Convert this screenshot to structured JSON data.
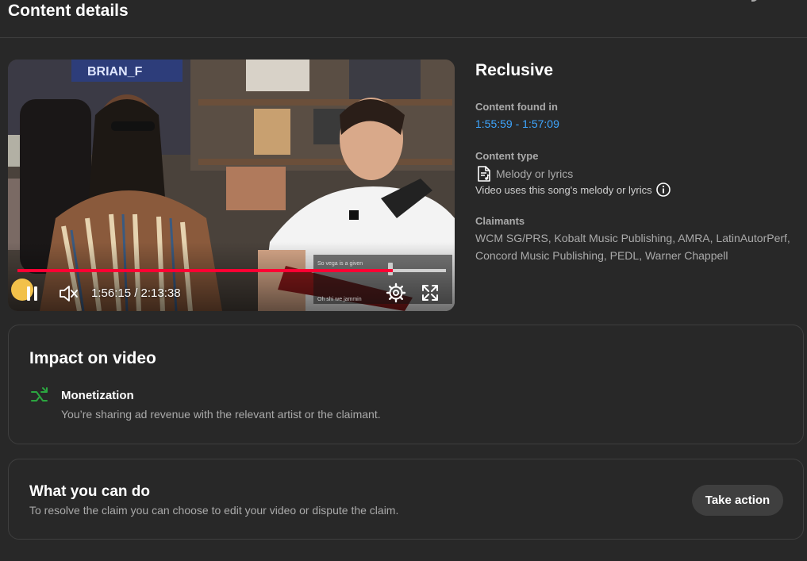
{
  "header": {
    "title": "Content details"
  },
  "player": {
    "time": "1:56:15 / 2:13:38",
    "progress_fraction": 0.875,
    "caption_line1": "So vega is a given",
    "caption_line2": "Oh shi we jammin",
    "overlay_sign": "BRIAN_F",
    "icons": {
      "pause": "pause-icon",
      "mute": "volume-muted-icon",
      "settings": "gear-icon",
      "fullscreen": "fullscreen-icon"
    }
  },
  "info": {
    "song_title": "Reclusive",
    "found_label": "Content found in",
    "found_value": "1:55:59 - 1:57:09",
    "type_label": "Content type",
    "type_value": "Melody or lyrics",
    "type_desc": "Video uses this song's melody or lyrics",
    "claimants_label": "Claimants",
    "claimants_value": "WCM SG/PRS, Kobalt Music Publishing, AMRA, LatinAutorPerf, Concord Music Publishing, PEDL, Warner Chappell"
  },
  "impact": {
    "title": "Impact on video",
    "monetization_title": "Monetization",
    "monetization_desc": "You’re sharing ad revenue with the relevant artist or the claimant."
  },
  "action": {
    "title": "What you can do",
    "desc": "To resolve the claim you can choose to edit your video or dispute the claim.",
    "button_label": "Take action"
  },
  "colors": {
    "background": "#282828",
    "link": "#3ea6ff",
    "progress": "#ff0033",
    "monetization_icon": "#2ba640"
  }
}
